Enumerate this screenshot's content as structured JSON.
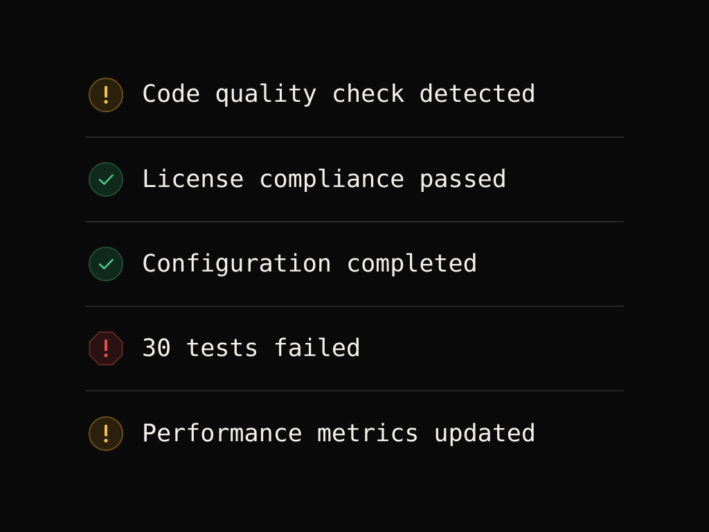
{
  "status_list": {
    "items": [
      {
        "label": "Code quality check detected",
        "status": "warning",
        "icon": "warning-icon"
      },
      {
        "label": "License compliance passed",
        "status": "success",
        "icon": "check-icon"
      },
      {
        "label": "Configuration completed",
        "status": "success",
        "icon": "check-icon"
      },
      {
        "label": "30 tests failed",
        "status": "error",
        "icon": "error-octagon-icon"
      },
      {
        "label": "Performance metrics updated",
        "status": "warning",
        "icon": "warning-icon"
      }
    ]
  },
  "colors": {
    "background": "#0b0a0a",
    "text": "#f2f1ed",
    "divider": "#262626",
    "warning": "#f3c34a",
    "success": "#4cc983",
    "error": "#e2524f"
  }
}
